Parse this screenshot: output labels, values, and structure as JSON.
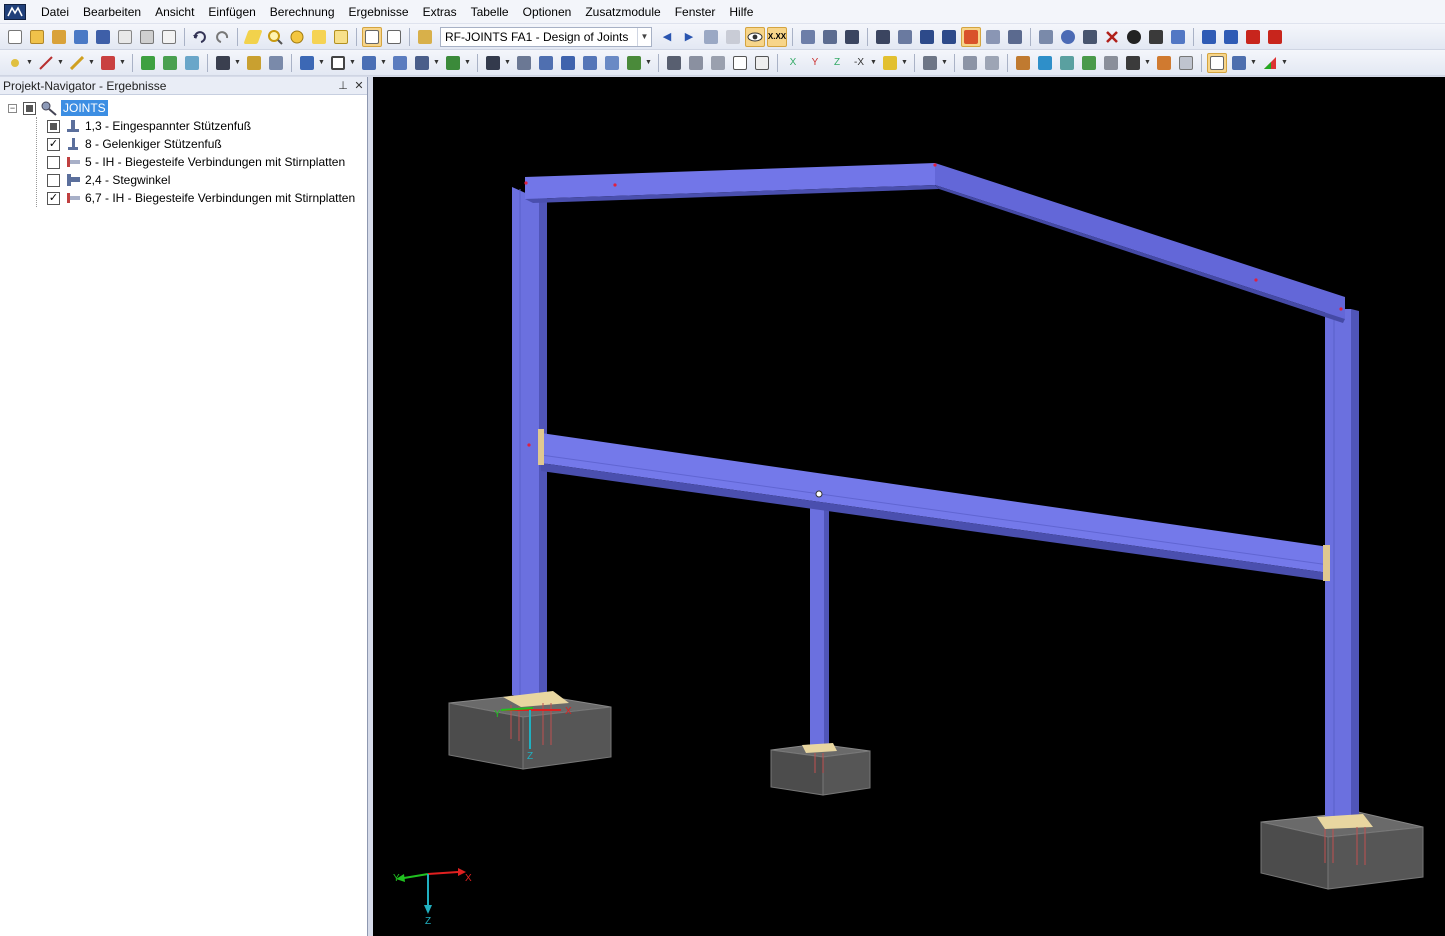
{
  "app": {
    "logo_icon": "rfem-logo-icon"
  },
  "menu": [
    "Datei",
    "Bearbeiten",
    "Ansicht",
    "Einfügen",
    "Berechnung",
    "Ergebnisse",
    "Extras",
    "Tabelle",
    "Optionen",
    "Zusatzmodule",
    "Fenster",
    "Hilfe"
  ],
  "toolbar": {
    "module_combo_value": "RF-JOINTS FA1 - Design of Joints"
  },
  "navigator": {
    "title": "Projekt-Navigator - Ergebnisse",
    "root": {
      "label": "JOINTS",
      "checkbox": "partial"
    },
    "items": [
      {
        "label": "1,3 - Eingespannter Stützenfuß",
        "checkbox": "partial",
        "icon": "fixed-column-base-icon"
      },
      {
        "label": "8 - Gelenkiger Stützenfuß",
        "checkbox": "checked",
        "icon": "pinned-column-base-icon"
      },
      {
        "label": "5 - IH - Biegesteife Verbindungen mit Stirnplatten",
        "checkbox": "unchecked",
        "icon": "end-plate-connection-icon"
      },
      {
        "label": "2,4 - Stegwinkel",
        "checkbox": "unchecked",
        "icon": "web-angle-icon"
      },
      {
        "label": "6,7 - IH - Biegesteife Verbindungen mit Stirnplatten",
        "checkbox": "checked",
        "icon": "end-plate-connection-icon"
      }
    ]
  },
  "viewport": {
    "background": "#000000",
    "member_color": "#6f74e6",
    "axes": {
      "x": "X",
      "y": "Y",
      "z": "Z"
    },
    "local_axes": {
      "x": "X",
      "y": "Y",
      "z": "Z"
    }
  },
  "colors": {
    "selection": "#3c8ee3",
    "active_tool": "#f7d58a"
  }
}
